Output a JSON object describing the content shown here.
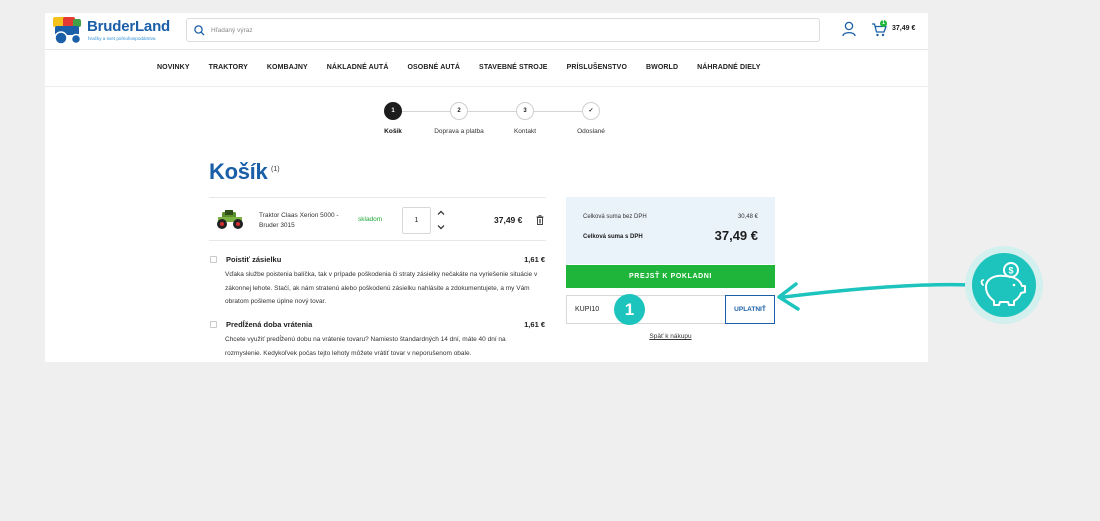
{
  "header": {
    "brand": "BruderLand",
    "tagline": "hračky a svet poľnohospodárstva",
    "search_placeholder": "Hľadaný výraz",
    "cart_count": "1",
    "cart_total": "37,49 €"
  },
  "nav": {
    "items": [
      "NOVINKY",
      "TRAKTORY",
      "KOMBAJNY",
      "NÁKLADNÉ AUTÁ",
      "OSOBNÉ AUTÁ",
      "STAVEBNÉ STROJE",
      "PRÍSLUŠENSTVO",
      "BWORLD",
      "NÁHRADNÉ DIELY"
    ]
  },
  "steps": [
    {
      "num": "1",
      "label": "Košík"
    },
    {
      "num": "2",
      "label": "Doprava a platba"
    },
    {
      "num": "3",
      "label": "Kontakt"
    },
    {
      "num": "✓",
      "label": "Odoslané"
    }
  ],
  "cart": {
    "title": "Košík",
    "count": "(1)",
    "item": {
      "name": "Traktor Claas Xerion 5000 - Bruder 3015",
      "stock": "skladom",
      "qty": "1",
      "price": "37,49 €"
    },
    "options": [
      {
        "title": "Poistiť zásielku",
        "price": "1,61 €",
        "desc": "Vďaka službe poistenia balíčka, tak v prípade poškodenia či straty zásielky nečakáte na vyriešenie situácie v zákonnej lehote. Stačí, ak nám stratenú alebo poškodenú zásielku nahlásite a zdokumentujete, a my Vám obratom pošleme úplne nový tovar."
      },
      {
        "title": "Predĺžená doba vrátenia",
        "price": "1,61 €",
        "desc": "Chcete využiť predĺženú dobu na vrátenie tovaru? Namiesto štandardných 14 dní, máte 40 dní na rozmyslenie. Kedykoľvek počas tejto lehoty môžete vrátiť tovar v neporušenom obale."
      }
    ]
  },
  "summary": {
    "ex_vat_label": "Celková suma bez DPH",
    "ex_vat_value": "30,48 €",
    "inc_vat_label": "Celková suma s DPH",
    "inc_vat_value": "37,49 €",
    "checkout_label": "PREJSŤ K POKLADNI",
    "coupon_value": "KUPI10",
    "apply_label": "UPLATNIŤ",
    "back_label": "Späť k nákupu"
  },
  "overlay": {
    "marker": "1"
  },
  "colors": {
    "brand_blue": "#1a5fa8",
    "green": "#1fb53a",
    "teal": "#1cc4bd",
    "summary_bg": "#eaf2fa"
  }
}
